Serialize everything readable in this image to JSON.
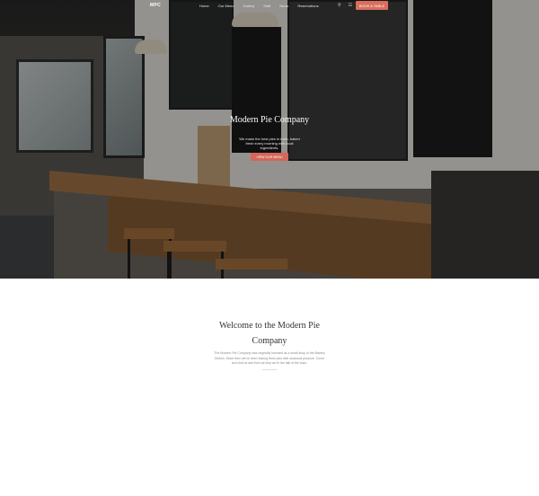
{
  "nav": {
    "logo": "MPC",
    "links": [
      "Home",
      "Our Menu",
      "Gallery",
      "Staff",
      "News",
      "Reservations"
    ],
    "icons": [
      "search-icon",
      "cart-icon"
    ],
    "cta": "BOOK A TABLE"
  },
  "hero": {
    "title": "Modern Pie Company",
    "subtitle": "We make the best pies in town, baked fresh every morning with local ingredients.",
    "button": "VIEW OUR MENU"
  },
  "welcome": {
    "title": "Welcome to the Modern Pie Company",
    "body": "The Modern Pie Company was originally founded as a small shop in the Bakery District. Since then we've been baking fresh pies with seasonal produce. Come and visit us and find out why we're the talk of the town."
  },
  "colors": {
    "accent": "#d86e5e",
    "text_dark": "#333333",
    "text_muted": "#8a8a8a"
  }
}
